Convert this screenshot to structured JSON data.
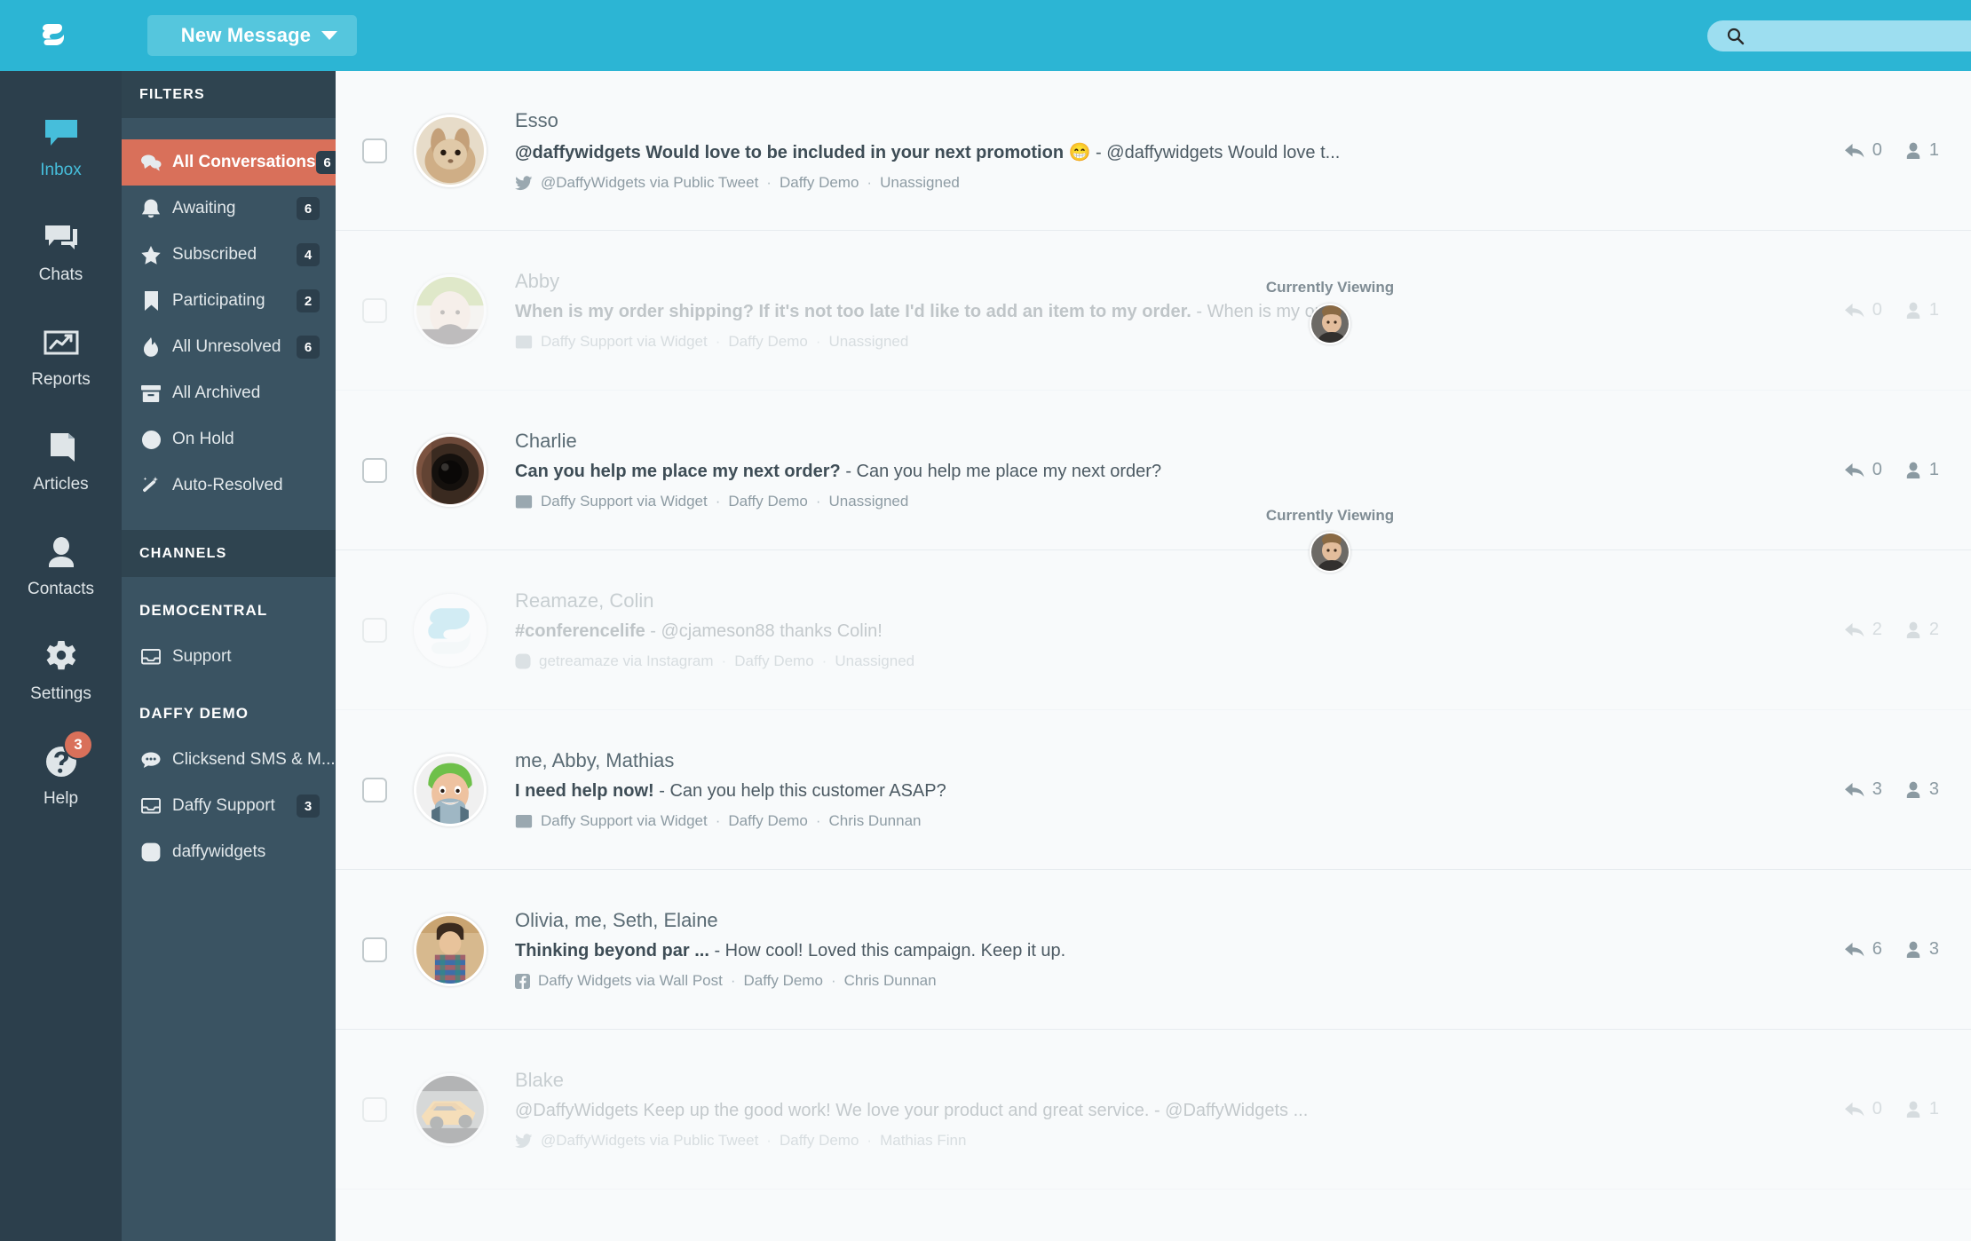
{
  "header": {
    "logo_icon": "reamaze-leaf-logo",
    "new_message_label": "New Message",
    "new_message_caret_icon": "chevron-down-icon",
    "search_icon": "search-icon",
    "search_value": "",
    "search_placeholder": ""
  },
  "rail": {
    "items": [
      {
        "label": "Inbox",
        "icon": "inbox-chat-icon",
        "active": true,
        "badge": ""
      },
      {
        "label": "Chats",
        "icon": "chats-icon",
        "active": false,
        "badge": ""
      },
      {
        "label": "Reports",
        "icon": "reports-chart-icon",
        "active": false,
        "badge": ""
      },
      {
        "label": "Articles",
        "icon": "articles-book-icon",
        "active": false,
        "badge": ""
      },
      {
        "label": "Contacts",
        "icon": "contacts-person-icon",
        "active": false,
        "badge": ""
      },
      {
        "label": "Settings",
        "icon": "gear-icon",
        "active": false,
        "badge": ""
      },
      {
        "label": "Help",
        "icon": "help-question-icon",
        "active": false,
        "badge": "3"
      }
    ]
  },
  "filters_panel": {
    "title": "FILTERS",
    "items": [
      {
        "label": "All Conversations",
        "icon": "conversations-bubbles-icon",
        "count": "6",
        "active": true
      },
      {
        "label": "Awaiting",
        "icon": "bell-icon",
        "count": "6",
        "active": false
      },
      {
        "label": "Subscribed",
        "icon": "star-icon",
        "count": "4",
        "active": false
      },
      {
        "label": "Participating",
        "icon": "bookmark-icon",
        "count": "2",
        "active": false
      },
      {
        "label": "All Unresolved",
        "icon": "flame-icon",
        "count": "6",
        "active": false
      },
      {
        "label": "All Archived",
        "icon": "archive-box-icon",
        "count": "",
        "active": false
      },
      {
        "label": "On Hold",
        "icon": "clock-icon",
        "count": "",
        "active": false
      },
      {
        "label": "Auto-Resolved",
        "icon": "magic-wand-icon",
        "count": "",
        "active": false
      }
    ]
  },
  "channels_panel": {
    "title": "CHANNELS",
    "groups": [
      {
        "name": "DEMOCENTRAL",
        "items": [
          {
            "label": "Support",
            "icon": "inbox-tray-icon",
            "count": ""
          }
        ]
      },
      {
        "name": "DAFFY DEMO",
        "items": [
          {
            "label": "Clicksend SMS & M...",
            "icon": "sms-bubble-icon",
            "count": ""
          },
          {
            "label": "Daffy Support",
            "icon": "inbox-tray-icon",
            "count": "3"
          },
          {
            "label": "daffywidgets",
            "icon": "instagram-icon",
            "count": ""
          }
        ]
      }
    ]
  },
  "conversations": [
    {
      "name": "Esso",
      "snippet_bold": "@daffywidgets Would love to be included in your next promotion 😁",
      "snippet_rest": " - @daffywidgets Would love t...",
      "channel_icon": "twitter-icon",
      "channel": "@DaffyWidgets via Public Tweet",
      "brand": "Daffy Demo",
      "assignee": "Unassigned",
      "replies": "0",
      "people": "1",
      "dimmed": false,
      "viewing_label": "",
      "avatar_colors": [
        "#c9a882",
        "#e3d5c0"
      ]
    },
    {
      "name": "Abby",
      "snippet_bold": "When is my order shipping? If it's not too late I'd like to add an item to my order.",
      "snippet_rest": " - When is my ord...",
      "channel_icon": "widget-icon",
      "channel": "Daffy Support via Widget",
      "brand": "Daffy Demo",
      "assignee": "Unassigned",
      "replies": "0",
      "people": "1",
      "dimmed": true,
      "viewing_label": "Currently Viewing",
      "avatar_colors": [
        "#9fb85c",
        "#3b3030"
      ]
    },
    {
      "name": "Charlie",
      "snippet_bold": "Can you help me place my next order?",
      "snippet_rest": " - Can you help me place my next order?",
      "channel_icon": "widget-icon",
      "channel": "Daffy Support via Widget",
      "brand": "Daffy Demo",
      "assignee": "Unassigned",
      "replies": "0",
      "people": "1",
      "dimmed": false,
      "viewing_label": "",
      "avatar_colors": [
        "#6e4a3a",
        "#1b1713"
      ]
    },
    {
      "name": "Reamaze, Colin",
      "snippet_bold": "#conferencelife",
      "snippet_rest": " - @cjameson88 thanks Colin!",
      "channel_icon": "instagram-icon",
      "channel": "getreamaze via Instagram",
      "brand": "Daffy Demo",
      "assignee": "Unassigned",
      "replies": "2",
      "people": "2",
      "dimmed": true,
      "viewing_label": "Currently Viewing",
      "avatar_colors": [
        "#ffffff",
        "#7ecfe6"
      ]
    },
    {
      "name": "me, Abby, Mathias",
      "snippet_bold": "I need help now!",
      "snippet_rest": " - Can you help this customer ASAP?",
      "channel_icon": "widget-icon",
      "channel": "Daffy Support via Widget",
      "brand": "Daffy Demo",
      "assignee": "Chris Dunnan",
      "replies": "3",
      "people": "3",
      "dimmed": false,
      "viewing_label": "",
      "avatar_colors": [
        "#6ec04a",
        "#e8bb92"
      ]
    },
    {
      "name": "Olivia, me, Seth, Elaine",
      "snippet_bold": "Thinking beyond par ...",
      "snippet_rest": " - How cool! Loved this campaign. Keep it up.",
      "channel_icon": "facebook-icon",
      "channel": "Daffy Widgets via Wall Post",
      "brand": "Daffy Demo",
      "assignee": "Chris Dunnan",
      "replies": "6",
      "people": "3",
      "dimmed": false,
      "viewing_label": "",
      "avatar_colors": [
        "#c9a471",
        "#3f6ea8"
      ]
    },
    {
      "name": "Blake",
      "snippet_bold": "",
      "snippet_rest": "@DaffyWidgets Keep up the good work! We love your product and great service. - @DaffyWidgets ...",
      "channel_icon": "twitter-icon",
      "channel": "@DaffyWidgets via Public Tweet",
      "brand": "Daffy Demo",
      "assignee": "Mathias Finn",
      "replies": "0",
      "people": "1",
      "dimmed": true,
      "viewing_label": "",
      "avatar_colors": [
        "#f0a024",
        "#2a2a2a"
      ]
    }
  ],
  "icons": {
    "reply_icon": "reply-arrow-icon",
    "person_icon": "person-icon",
    "checkbox_icon": "checkbox-unchecked"
  },
  "colors": {
    "header_blue": "#2cb5d4",
    "accent_coral": "#d9705a",
    "rail_dark": "#2c3f4c",
    "panel_slate": "#3a5362",
    "list_bg": "#f8fafb"
  }
}
